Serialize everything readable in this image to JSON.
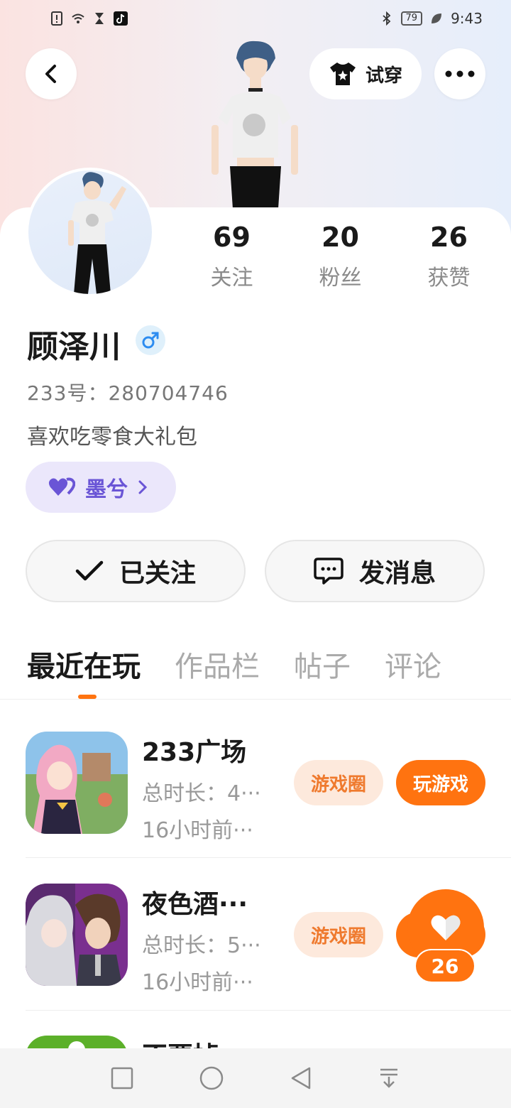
{
  "status_bar": {
    "battery": "79",
    "time": "9:43"
  },
  "top_bar": {
    "tryon_label": "试穿"
  },
  "profile": {
    "name": "顾泽川",
    "uid": "233号：280704746",
    "bio": "喜欢吃零食大礼包",
    "tag": "墨兮",
    "stats": [
      {
        "num": "69",
        "label": "关注"
      },
      {
        "num": "20",
        "label": "粉丝"
      },
      {
        "num": "26",
        "label": "获赞"
      }
    ]
  },
  "actions": {
    "followed": "已关注",
    "message": "发消息"
  },
  "tabs": [
    "最近在玩",
    "作品栏",
    "帖子",
    "评论"
  ],
  "games": [
    {
      "title": "233广场",
      "duration": "总时长：4···",
      "ago": "16小时前···",
      "circle": "游戏圈",
      "play": "玩游戏"
    },
    {
      "title": "夜色酒···",
      "duration": "总时长：5···",
      "ago": "16小时前···",
      "circle": "游戏圈",
      "play": ""
    },
    {
      "title": "不要掉",
      "duration": "",
      "ago": "",
      "circle": "",
      "play": ""
    }
  ],
  "like_float": {
    "count": "26"
  },
  "colors": {
    "accent": "#ff7310",
    "tag_purple": "#6a55d6"
  }
}
